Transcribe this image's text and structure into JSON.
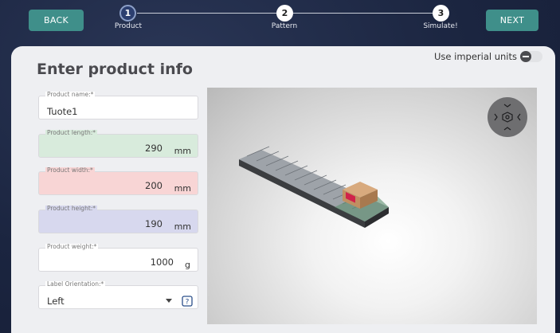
{
  "topbar": {
    "back_label": "BACK",
    "next_label": "NEXT",
    "steps": [
      {
        "number": "1",
        "label": "Product",
        "state": "active"
      },
      {
        "number": "2",
        "label": "Pattern",
        "state": "inactive"
      },
      {
        "number": "3",
        "label": "Simulate!",
        "state": "inactive"
      }
    ]
  },
  "panel": {
    "title": "Enter product info",
    "imperial_label": "Use imperial units",
    "imperial_enabled": false
  },
  "form": {
    "name": {
      "label": "Product name:*",
      "value": "Tuote1"
    },
    "length": {
      "label": "Product length:*",
      "value": "290",
      "unit": "mm"
    },
    "width": {
      "label": "Product width:*",
      "value": "200",
      "unit": "mm"
    },
    "height": {
      "label": "Product height:*",
      "value": "190",
      "unit": "mm"
    },
    "weight": {
      "label": "Product weight:*",
      "value": "1000",
      "unit": "g"
    },
    "label_orientation": {
      "label": "Label Orientation:*",
      "value": "Left"
    }
  },
  "colors": {
    "accent": "#3f8f8a",
    "length_bg": "#d8ebdc",
    "width_bg": "#f8d5d5",
    "height_bg": "#d7d8ee"
  },
  "icons": {
    "help": "help-circle-icon",
    "view": "view-navigation-icon",
    "imperial_toggle": "minus-toggle-icon"
  }
}
